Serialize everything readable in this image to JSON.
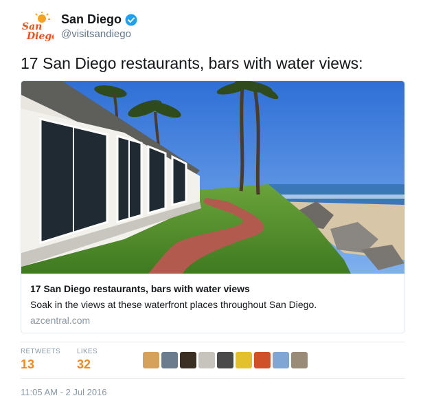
{
  "account": {
    "display_name": "San Diego",
    "handle": "@visitsandiego",
    "avatar_text": "San Diego",
    "verified": true
  },
  "tweet": {
    "text": "17 San Diego restaurants, bars with water views:"
  },
  "card": {
    "image_description": "waterfront-restaurant-with-palm-trees",
    "title": "17 San Diego restaurants, bars with water views",
    "description": "Soak in the views at these waterfront places throughout San Diego.",
    "domain": "azcentral.com"
  },
  "stats": {
    "retweets_label": "RETWEETS",
    "retweets_count": "13",
    "likes_label": "LIKES",
    "likes_count": "32",
    "liker_avatar_count": 9
  },
  "timestamp": "11:05 AM - 2 Jul 2016",
  "colors": {
    "accent": "#f5891f",
    "verified": "#1da1f2",
    "muted": "#8899a6"
  }
}
